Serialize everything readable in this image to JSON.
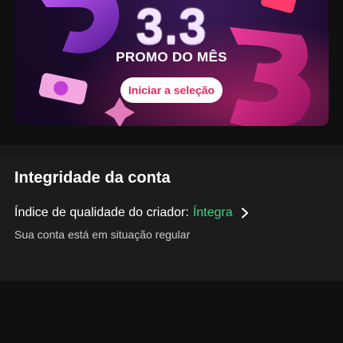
{
  "banner": {
    "number": "3.3",
    "subtitle": "PROMO DO MÊS",
    "cta_label": "Iniciar a seleção"
  },
  "account": {
    "title": "Integridade da conta",
    "quality_label": "Índice de qualidade do criador:",
    "quality_value": "Íntegra",
    "status": "Sua conta está em situação regular"
  },
  "colors": {
    "accent_pink": "#e0285a",
    "status_green": "#3ed28a"
  }
}
